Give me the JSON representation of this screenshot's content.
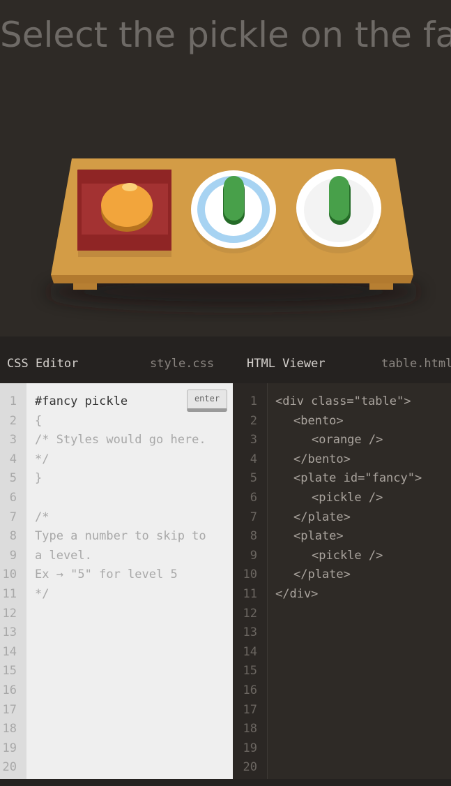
{
  "level": {
    "instruction": "Select the pickle on the fancy plate"
  },
  "table": {
    "items": [
      {
        "type": "bento",
        "contents": "orange"
      },
      {
        "type": "plate",
        "id": "fancy",
        "contents": "pickle"
      },
      {
        "type": "plate",
        "contents": "pickle"
      }
    ]
  },
  "tabs": {
    "css_title": "CSS Editor",
    "css_file": "style.css",
    "html_title": "HTML Viewer",
    "html_file": "table.html"
  },
  "css_editor": {
    "input_value": "#fancy pickle",
    "enter_label": "enter",
    "lines": [
      "{",
      "/* Styles would go here.",
      "*/",
      "}",
      "",
      "/*",
      "Type a number to skip to",
      "a level.",
      "Ex → \"5\" for level 5",
      "*/"
    ],
    "line_numbers": [
      "1",
      "2",
      "3",
      "4",
      "5",
      "6",
      "7",
      "8",
      "9",
      "10",
      "11",
      "12",
      "13",
      "14",
      "15",
      "16",
      "17",
      "18",
      "19",
      "20"
    ]
  },
  "html_viewer": {
    "lines": [
      "<div class=\"table\">",
      "<bento>",
      "<orange />",
      "</bento>",
      "<plate id=\"fancy\">",
      "<pickle />",
      "</plate>",
      "<plate>",
      "<pickle />",
      "</plate>",
      "</div>"
    ],
    "line_numbers": [
      "1",
      "2",
      "3",
      "4",
      "5",
      "6",
      "7",
      "8",
      "9",
      "10",
      "11",
      "12",
      "13",
      "14",
      "15",
      "16",
      "17",
      "18",
      "19",
      "20"
    ]
  },
  "colors": {
    "background": "#2e2a26",
    "table": "#d39c46",
    "bento": "#8f2525",
    "orange": "#f2a53c",
    "pickle": "#48a04a",
    "fancy_plate_rim": "#a7d3f2",
    "plate": "#ffffff"
  }
}
